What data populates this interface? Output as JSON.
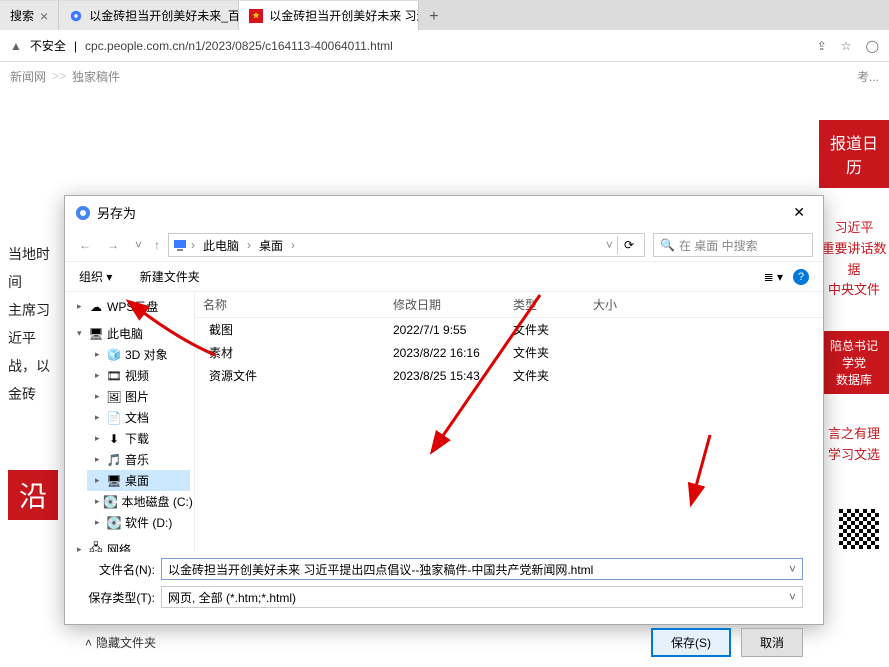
{
  "tabs": [
    {
      "title": "搜索"
    },
    {
      "title": "以金砖担当开创美好未来_百度搜"
    },
    {
      "title": "以金砖担当开创美好未来 习近平"
    }
  ],
  "address": {
    "insecure": "不安全",
    "url": "cpc.people.com.cn/n1/2023/0825/c164113-40064011.html"
  },
  "breadcrumb": {
    "a": "新闻网",
    "b": "独家稿件",
    "tail": "考..."
  },
  "article": {
    "l1": "当地时间",
    "l2": "主席习近平",
    "l3": "战，以金砖"
  },
  "sidebar": {
    "banner": "报道日历",
    "link1": "习近平",
    "link2": "重要讲话数据",
    "link3": "中央文件",
    "block2a": "陪总书记学党",
    "block2b": "数据库",
    "link4": "言之有理",
    "link5": "学习文选"
  },
  "dialog": {
    "title": "另存为",
    "path": {
      "thispc": "此电脑",
      "desktop": "桌面"
    },
    "search_ph": "在 桌面 中搜索",
    "toolbar": {
      "organize": "组织",
      "newfolder": "新建文件夹"
    },
    "tree": {
      "wps": "WPS云盘",
      "thispc": "此电脑",
      "d3d": "3D 对象",
      "video": "视频",
      "pictures": "图片",
      "docs": "文档",
      "downloads": "下载",
      "music": "音乐",
      "desktop": "桌面",
      "cdrive": "本地磁盘 (C:)",
      "ddrive": "软件 (D:)",
      "network": "网络"
    },
    "columns": {
      "name": "名称",
      "date": "修改日期",
      "type": "类型",
      "size": "大小"
    },
    "rows": [
      {
        "name": "截图",
        "date": "2022/7/1 9:55",
        "type": "文件夹"
      },
      {
        "name": "素材",
        "date": "2023/8/22 16:16",
        "type": "文件夹"
      },
      {
        "name": "资源文件",
        "date": "2023/8/25 15:43",
        "type": "文件夹"
      }
    ],
    "filename_label": "文件名(N):",
    "filename_value": "以金砖担当开创美好未来 习近平提出四点倡议--独家稿件-中国共产党新闻网.html",
    "savetype_label": "保存类型(T):",
    "savetype_value": "网页, 全部 (*.htm;*.html)",
    "hide_folders": "隐藏文件夹",
    "save_btn": "保存(S)",
    "cancel_btn": "取消"
  }
}
